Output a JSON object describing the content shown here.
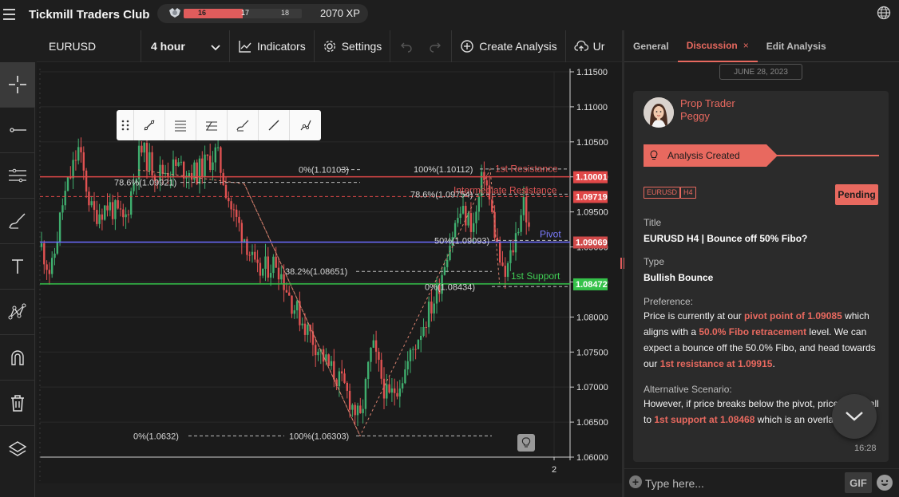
{
  "app": {
    "title": "Tickmill Traders Club"
  },
  "xp": {
    "current_level": "16",
    "mid_marker": "17",
    "next_level": "18",
    "progress": 0.5,
    "points": "2070 XP"
  },
  "toolbar": {
    "symbol": "EURUSD",
    "timeframe": "4 hour",
    "indicators_label": "Indicators",
    "settings_label": "Settings",
    "create_analysis_label": "Create Analysis",
    "upload_label": "Ur"
  },
  "chart": {
    "price_ticks": [
      "1.11500",
      "1.11000",
      "1.10500",
      "1.10000",
      "1.09500",
      "1.09000",
      "1.08500",
      "1.08000",
      "1.07500",
      "1.07000",
      "1.06500",
      "1.06000"
    ],
    "time_tick": "2",
    "current_price_tag": "1.09069",
    "levels": [
      {
        "name": "1st Resistance",
        "price": 1.10001,
        "tag": "1.10001",
        "color": "#e04848"
      },
      {
        "name": "Intermediate Resistance",
        "price": 1.09719,
        "tag": "1.09719",
        "color": "#e04848"
      },
      {
        "name": "Pivot",
        "price": 1.09069,
        "tag": "1.09069",
        "color": "#6b6bff"
      },
      {
        "name": "1st Support",
        "price": 1.08472,
        "tag": "1.08472",
        "color": "#35c24a"
      }
    ],
    "fib_left": [
      {
        "text": "0%(1.10103)",
        "price": 1.10103
      },
      {
        "text": "78.6%(1.09921)",
        "price": 1.09921
      },
      {
        "text": "38.2%(1.08651)",
        "price": 1.08651
      },
      {
        "text": "100%(1.06303)",
        "price": 1.06303
      },
      {
        "text": "0%(1.0632)",
        "price": 1.06303
      }
    ],
    "fib_right": [
      {
        "text": "100%(1.10112)",
        "price": 1.10112
      },
      {
        "text": "78.6%(1.09754)",
        "price": 1.09754
      },
      {
        "text": "50%(1.09093)",
        "price": 1.09093
      },
      {
        "text": "0%(1.08434)",
        "price": 1.08434
      }
    ],
    "colors": {
      "up": "#3fae6e",
      "down": "#e05252",
      "grid": "#2a2a2a"
    }
  },
  "panel": {
    "tabs": [
      {
        "label": "General"
      },
      {
        "label": "Discussion"
      },
      {
        "label": "Edit Analysis"
      }
    ],
    "date": "JUNE 28, 2023",
    "author": {
      "role": "Prop Trader",
      "name": "Peggy"
    },
    "status": "Analysis Created",
    "tags": [
      "EURUSD",
      "H4"
    ],
    "pending_label": "Pending",
    "title_label": "Title",
    "title_value": "EURUSD H4 | Bounce off 50% Fibo?",
    "type_label": "Type",
    "type_value": "Bullish Bounce",
    "preference_label": "Preference:",
    "preference": {
      "p1": "Price is currently at our ",
      "h1": "pivot point of 1.09085",
      "p2": " which aligns with a ",
      "h2": "50.0% Fibo retracement",
      "p3": " level. We can expect a bounce off the 50.0% Fibo, and head towards our ",
      "h3": "1st resistance at 1.09915",
      "p4": "."
    },
    "alt_label": "Alternative Scenario:",
    "alternative": {
      "p1": "However, if price breaks below the pivot, price could fall to ",
      "h1": "1st support at 1.08468",
      "p2": " which is an overlap"
    },
    "time": "16:28",
    "composer_placeholder": "Type here...",
    "gif_label": "GIF"
  }
}
